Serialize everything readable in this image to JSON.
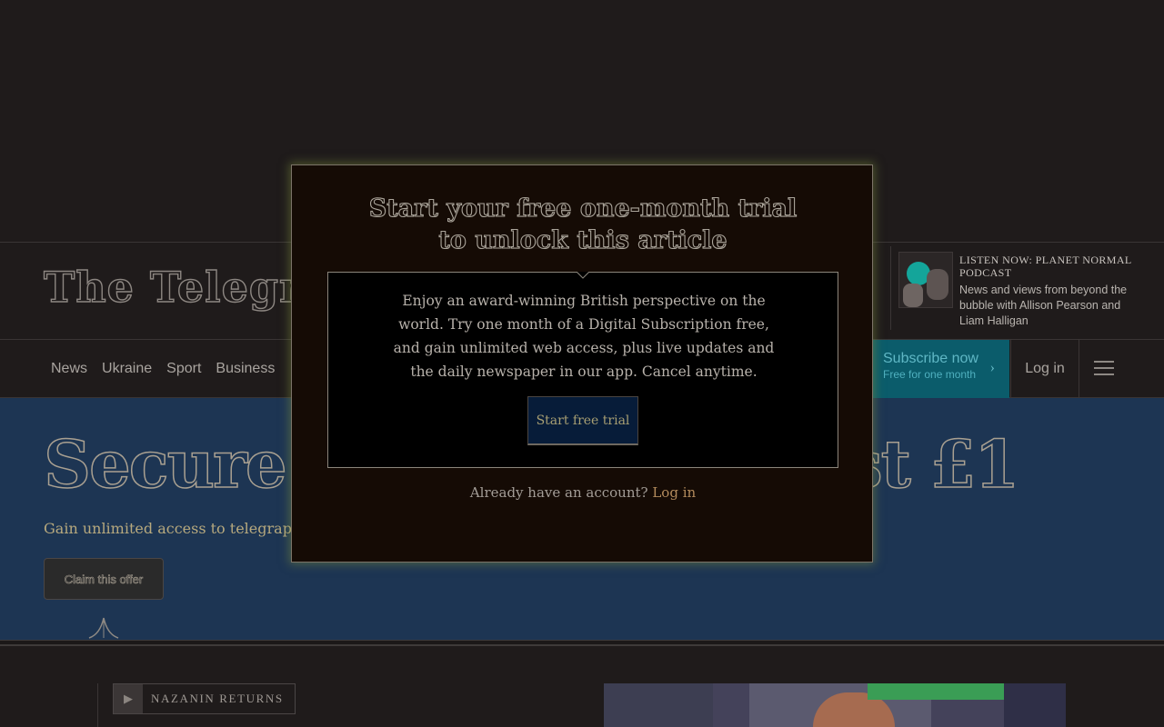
{
  "masthead": {
    "logo_text": "The Telegraph",
    "podcast": {
      "title": "LISTEN NOW: PLANET NORMAL PODCAST",
      "description": "News and views from beyond the bubble with Allison Pearson and Liam Halligan"
    }
  },
  "nav": {
    "items": [
      "News",
      "Ukraine",
      "Sport",
      "Business"
    ],
    "subscribe_label": "Subscribe now",
    "subscribe_sub": "Free for one month",
    "login_label": "Log in"
  },
  "promo": {
    "title": "Secure 3 months for just £1",
    "subtitle": "Gain unlimited access to telegraph.co.uk",
    "cta_label": "Claim this offer"
  },
  "bottom": {
    "tag_label": "NAZANIN RETURNS"
  },
  "modal": {
    "title_line1": "Start your free one-month trial",
    "title_line2": "to unlock this article",
    "body": "Enjoy an award-winning British perspective on the world. Try one month of a Digital Subscription free, and gain unlimited web access, plus live updates and the daily newspaper in our app. Cancel anytime.",
    "cta_label": "Start free trial",
    "footer_text": "Already have an account?",
    "footer_link": "Log in"
  }
}
